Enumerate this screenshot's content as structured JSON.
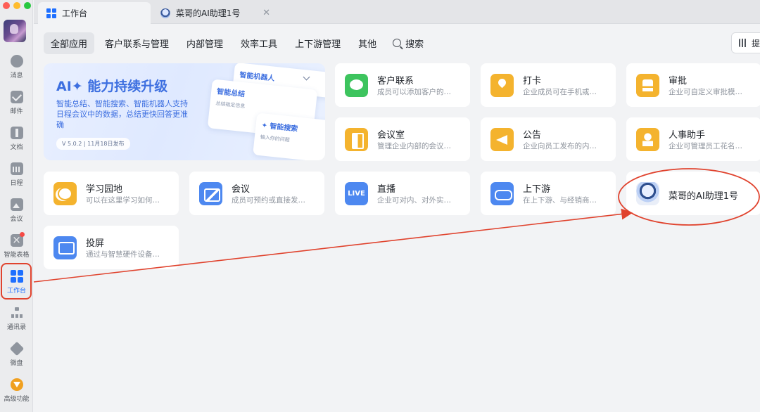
{
  "rail": {
    "items": [
      {
        "label": "消息"
      },
      {
        "label": "邮件"
      },
      {
        "label": "文档"
      },
      {
        "label": "日程"
      },
      {
        "label": "会议"
      },
      {
        "label": "智能表格"
      },
      {
        "label": "工作台"
      },
      {
        "label": "通讯录"
      },
      {
        "label": "微盘"
      },
      {
        "label": "高级功能"
      }
    ]
  },
  "tabs": [
    {
      "label": "工作台"
    },
    {
      "label": "菜哥的AI助理1号"
    }
  ],
  "categories": [
    "全部应用",
    "客户联系与管理",
    "内部管理",
    "效率工具",
    "上下游管理",
    "其他"
  ],
  "search": {
    "label": "搜索"
  },
  "hint_button": {
    "label": "提"
  },
  "banner": {
    "title": "AI✦ 能力持续升级",
    "desc": "智能总结、智能搜索、智能机器人支持日程会议中的数据，总结更快回答更准确",
    "version": "V 5.0.2 | 11月18日发布",
    "card_robot": "智能机器人",
    "card_summary": "智能总结",
    "card_summary_sub": "总结指定信息",
    "card_search": "✦ 智能搜索",
    "card_search_sub": "输入你的问题"
  },
  "apps": [
    {
      "name": "客户联系",
      "desc": "成员可以添加客户的…"
    },
    {
      "name": "打卡",
      "desc": "企业成员可在手机或…"
    },
    {
      "name": "审批",
      "desc": "企业可自定义审批模…"
    },
    {
      "name": "会议室",
      "desc": "管理企业内部的会议…"
    },
    {
      "name": "公告",
      "desc": "企业向员工发布的内…"
    },
    {
      "name": "人事助手",
      "desc": "企业可管理员工花名…"
    },
    {
      "name": "学习园地",
      "desc": "可以在这里学习如何…"
    },
    {
      "name": "会议",
      "desc": "成员可预约或直接发…"
    },
    {
      "name": "直播",
      "desc": "企业可对内、对外实…"
    },
    {
      "name": "上下游",
      "desc": "在上下游、与经销商…"
    },
    {
      "name": "菜哥的AI助理1号",
      "desc": ""
    },
    {
      "name": "投屏",
      "desc": "通过与智慧硬件设备…"
    }
  ],
  "live_icon_text": "LIVE",
  "colors": {
    "accent": "#1e6fff",
    "annotation": "#e0432e",
    "green": "#3dc45e",
    "amber": "#f4b32e",
    "blue": "#4d88f0"
  }
}
